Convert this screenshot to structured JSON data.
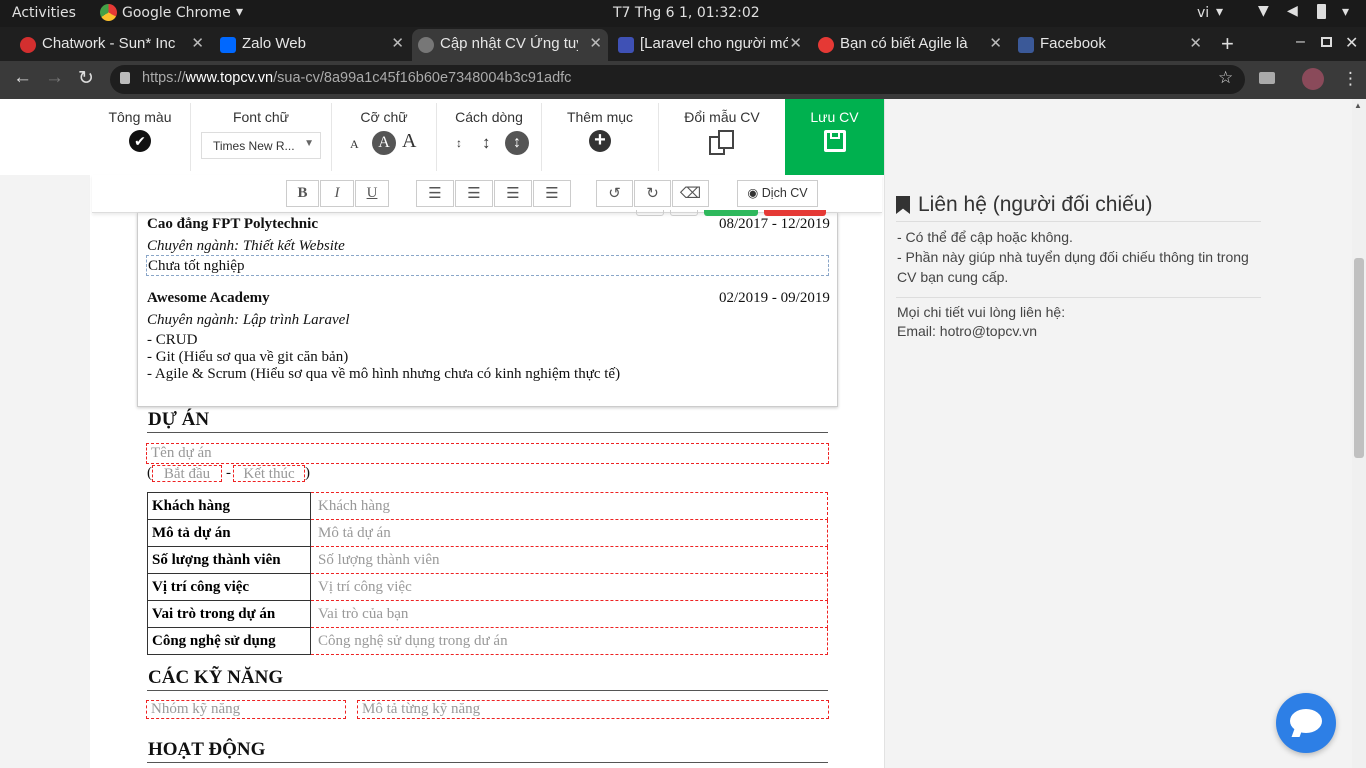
{
  "os": {
    "activities": "Activities",
    "app": "Google Chrome",
    "clock": "T7 Thg 6  1, 01:32:02",
    "lang": "vi"
  },
  "tabs": [
    {
      "title": "Chatwork - Sun* Inc",
      "color": "#d32f2f"
    },
    {
      "title": "Zalo Web",
      "color": "#0068ff"
    },
    {
      "title": "Cập nhật CV Ứng tuyển",
      "color": "#777"
    },
    {
      "title": "[Laravel cho người mới]",
      "color": "#3f51b5"
    },
    {
      "title": "Bạn có biết Agile là gì",
      "color": "#e53935"
    },
    {
      "title": "Facebook",
      "color": "#3b5998"
    }
  ],
  "url": {
    "scheme": "https://",
    "host": "www.topcv.vn",
    "path": "/sua-cv/8a99a1c45f16b60e7348004b3c91adfc"
  },
  "toolbar": {
    "color": "Tông màu",
    "font": "Font chữ",
    "font_value": "Times New R...",
    "size": "Cỡ chữ",
    "spacing": "Cách dòng",
    "add": "Thêm mục",
    "template": "Đổi mẫu CV",
    "save": "Lưu CV",
    "translate": "Dịch CV",
    "save_bg": "#00b14f"
  },
  "education": [
    {
      "school": "Cao đẳng FPT Polytechnic",
      "date": "08/2017 - 12/2019",
      "major": "Chuyên ngành: Thiết kết Website",
      "note": "Chưa tốt nghiệp"
    },
    {
      "school": "Awesome Academy",
      "date": "02/2019 - 09/2019",
      "major": "Chuyên ngành: Lập trình Laravel",
      "lines": [
        "- CRUD",
        "- Git (Hiểu sơ qua về git căn bản)",
        "- Agile & Scrum (Hiểu sơ qua về mô hình nhưng chưa có kinh nghiệm thực tế)"
      ]
    }
  ],
  "project": {
    "heading": "DỰ ÁN",
    "name_ph": "Tên dự án",
    "start_ph": "Bắt đầu",
    "end_ph": "Kết thúc",
    "rows": [
      {
        "k": "Khách hàng",
        "v": "Khách hàng"
      },
      {
        "k": "Mô tả dự án",
        "v": "Mô tả dự án"
      },
      {
        "k": "Số lượng thành viên",
        "v": "Số lượng thành viên"
      },
      {
        "k": "Vị trí công việc",
        "v": "Vị trí công việc"
      },
      {
        "k": "Vai trò trong dự án",
        "v": "Vai trò của bạn"
      },
      {
        "k": "Công nghệ sử dụng",
        "v": "Công nghệ sử dụng trong dư án"
      }
    ]
  },
  "skills": {
    "heading": "CÁC KỸ NĂNG",
    "group_ph": "Nhóm kỹ năng",
    "desc_ph": "Mô tả từng kỹ năng"
  },
  "activity": {
    "heading": "HOẠT ĐỘNG"
  },
  "sidebar": {
    "title": "Liên hệ (người đối chiếu)",
    "l1": "- Có thể để cập hoặc không.",
    "l2": "- Phần này giúp nhà tuyển dụng đối chiếu thông tin trong",
    "l3": "CV bạn cung cấp.",
    "l4": "Mọi chi tiết vui lòng liên hệ:",
    "l5": "Email: hotro@topcv.vn"
  },
  "chat": {
    "color": "#2d7fe6"
  }
}
